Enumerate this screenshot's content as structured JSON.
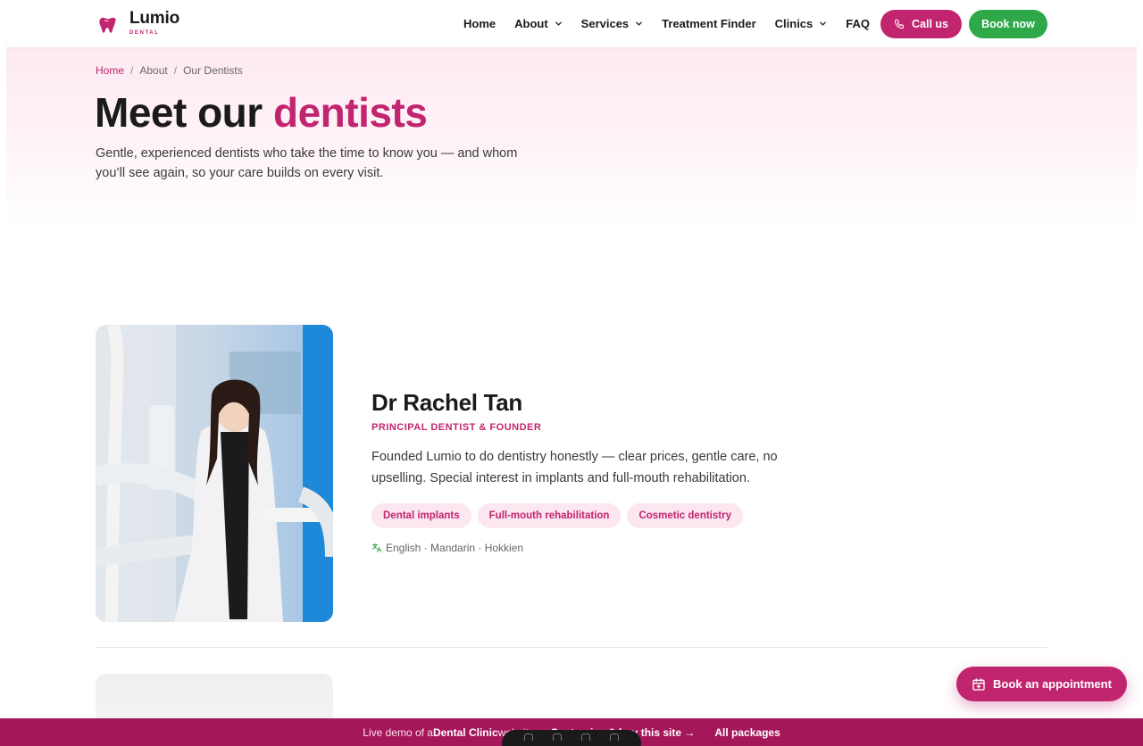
{
  "brand": {
    "name": "Lumio",
    "sub": "DENTAL",
    "color": "#c2256f"
  },
  "nav": {
    "items": [
      {
        "label": "Home",
        "dropdown": false
      },
      {
        "label": "About",
        "dropdown": true
      },
      {
        "label": "Services",
        "dropdown": true
      },
      {
        "label": "Treatment Finder",
        "dropdown": false
      },
      {
        "label": "Clinics",
        "dropdown": true
      },
      {
        "label": "FAQ",
        "dropdown": false
      }
    ],
    "call_label": "Call us",
    "book_label": "Book now",
    "book_color": "#2fa84a"
  },
  "breadcrumb": {
    "home": "Home",
    "about": "About",
    "current": "Our Dentists",
    "separator": "/"
  },
  "hero": {
    "title_start": "Meet our ",
    "title_accent": "dentists",
    "subtitle": "Gentle, experienced dentists who take the time to know you — and whom you’ll see again, so your care builds on every visit."
  },
  "dentists": [
    {
      "name": "Dr Rachel Tan",
      "role": "PRINCIPAL DENTIST & FOUNDER",
      "bio": "Founded Lumio to do dentistry honestly — clear prices, gentle care, no upselling. Special interest in implants and full-mouth rehabilitation.",
      "tags": [
        "Dental implants",
        "Full-mouth rehabilitation",
        "Cosmetic dentistry"
      ],
      "languages": "English · Mandarin · Hokkien",
      "languages_icon": "translate-icon"
    }
  ],
  "fab": {
    "label": "Book an appointment",
    "icon": "calendar-plus-icon"
  },
  "demo_bar": {
    "prefix": "Live demo of a ",
    "site_type": "Dental Clinic",
    "site_suffix": " website",
    "cta": "Customise & buy this site →",
    "packages": "All packages"
  }
}
